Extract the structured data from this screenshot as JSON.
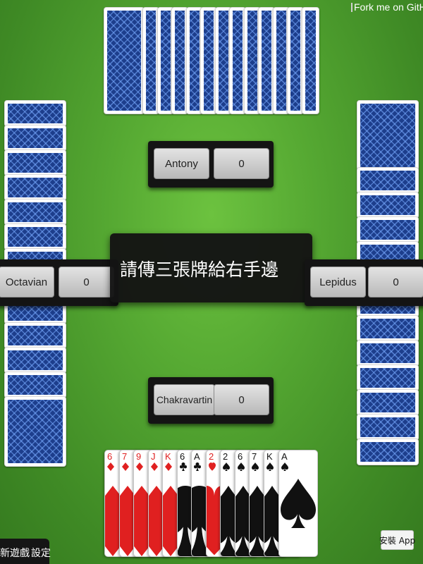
{
  "github_ribbon": {
    "text": "Fork me on GitHub"
  },
  "players": {
    "north": {
      "name": "Antony",
      "score": "0"
    },
    "west": {
      "name": "Octavian",
      "score": "0"
    },
    "east": {
      "name": "Lepidus",
      "score": "0"
    },
    "south": {
      "name": "Chakravartin",
      "score": "0"
    }
  },
  "message": "請傳三張牌給右手邊",
  "hand": [
    {
      "rank": "6",
      "suit": "diamonds",
      "color": "#e02020"
    },
    {
      "rank": "7",
      "suit": "diamonds",
      "color": "#e02020"
    },
    {
      "rank": "9",
      "suit": "diamonds",
      "color": "#e02020"
    },
    {
      "rank": "J",
      "suit": "diamonds",
      "color": "#e02020"
    },
    {
      "rank": "K",
      "suit": "diamonds",
      "color": "#e02020"
    },
    {
      "rank": "6",
      "suit": "clubs",
      "color": "#111111"
    },
    {
      "rank": "A",
      "suit": "clubs",
      "color": "#111111"
    },
    {
      "rank": "2",
      "suit": "hearts",
      "color": "#e02020"
    },
    {
      "rank": "2",
      "suit": "spades",
      "color": "#111111"
    },
    {
      "rank": "6",
      "suit": "spades",
      "color": "#111111"
    },
    {
      "rank": "7",
      "suit": "spades",
      "color": "#111111"
    },
    {
      "rank": "K",
      "suit": "spades",
      "color": "#111111"
    },
    {
      "rank": "A",
      "suit": "spades",
      "color": "#111111"
    }
  ],
  "controls": {
    "new_game": "新遊戲",
    "settings": "設定",
    "install_app": "安裝 App"
  }
}
